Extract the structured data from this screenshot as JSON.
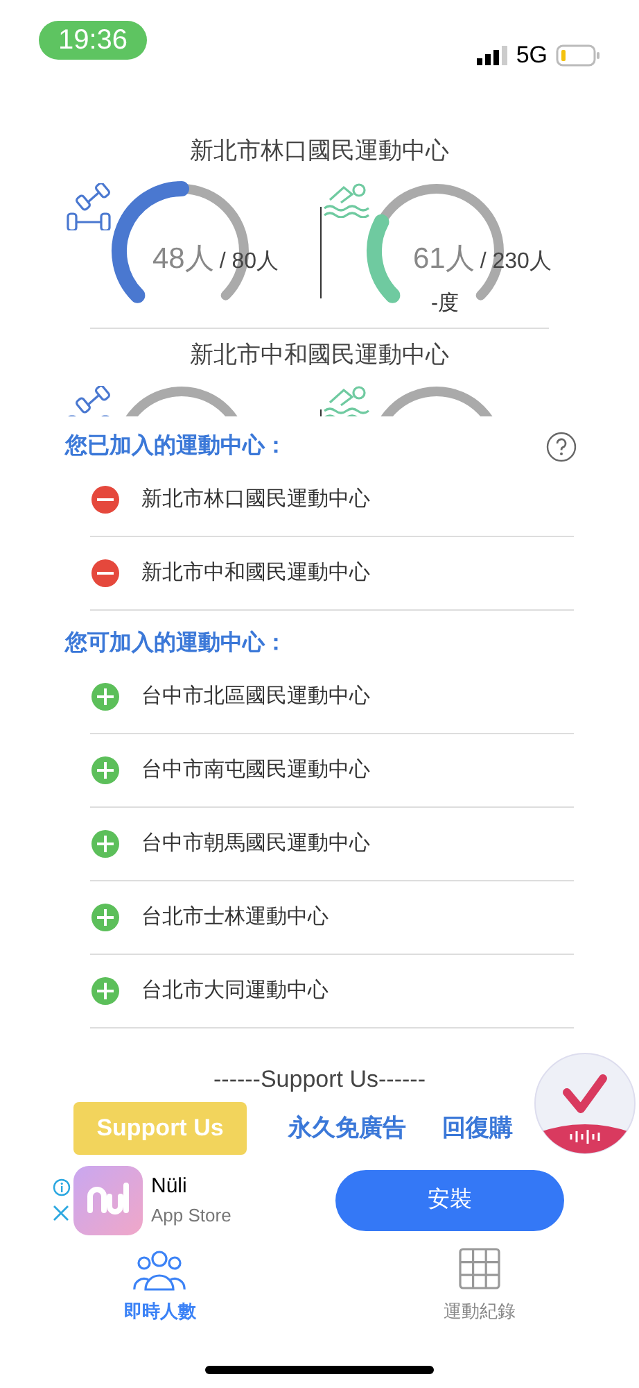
{
  "status_bar": {
    "time": "19:36",
    "network": "5G"
  },
  "centers": [
    {
      "name": "新北市林口國民運動中心",
      "gauges": [
        {
          "kind": "gym",
          "count": "48人",
          "capacity": "/ 80人"
        },
        {
          "kind": "swim",
          "count": "61人",
          "capacity": "/ 230人",
          "note": "-度"
        }
      ]
    },
    {
      "name": "新北市中和國民運動中心",
      "gauges": [
        {
          "kind": "gym"
        },
        {
          "kind": "swim"
        }
      ]
    }
  ],
  "joined": {
    "heading": "您已加入的運動中心：",
    "items": [
      {
        "name": "新北市林口國民運動中心"
      },
      {
        "name": "新北市中和國民運動中心"
      }
    ]
  },
  "available": {
    "heading": "您可加入的運動中心：",
    "items": [
      {
        "name": "台中市北區國民運動中心"
      },
      {
        "name": "台中市南屯國民運動中心"
      },
      {
        "name": "台中市朝馬國民運動中心"
      },
      {
        "name": "台北市士林運動中心"
      },
      {
        "name": "台北市大同運動中心"
      }
    ]
  },
  "support": {
    "title": "------Support Us------",
    "button": "Support Us",
    "links": [
      "永久免廣告",
      "回復購"
    ]
  },
  "ad": {
    "app_name": "Nüli",
    "store": "App Store",
    "button": "安裝"
  },
  "tabs": [
    {
      "label": "即時人數",
      "kind": "people",
      "selected": true
    },
    {
      "label": "運動紀錄",
      "kind": "grid",
      "selected": false
    }
  ]
}
